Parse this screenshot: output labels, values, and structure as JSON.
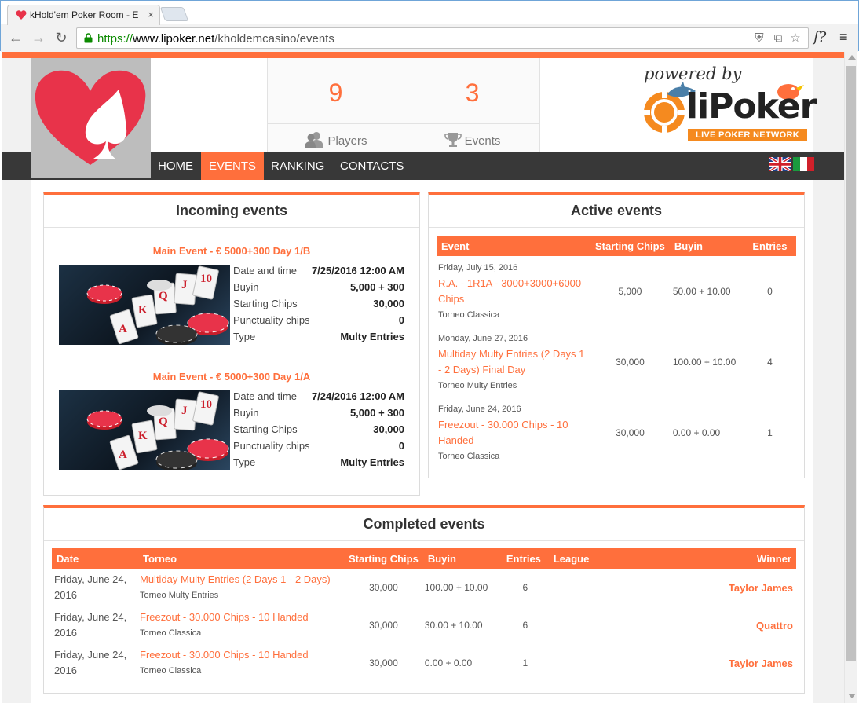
{
  "browser": {
    "tab_title": "kHold'em Poker Room - E",
    "url_scheme": "https://",
    "url_host": "www.lipoker.net",
    "url_path": "/kholdemcasino/events"
  },
  "header": {
    "stats": [
      {
        "value": "9",
        "label": "Players"
      },
      {
        "value": "3",
        "label": "Events"
      }
    ],
    "sponsor": {
      "powered_by": "powered by",
      "brand_prefix": "li",
      "brand_main": "Poker",
      "tagline": "LIVE POKER NETWORK"
    }
  },
  "nav": {
    "items": [
      {
        "label": "HOME"
      },
      {
        "label": "EVENTS"
      },
      {
        "label": "RANKING"
      },
      {
        "label": "CONTACTS"
      }
    ],
    "active": "EVENTS"
  },
  "incoming": {
    "title": "Incoming events",
    "events": [
      {
        "name": "Main Event - € 5000+300 Day 1/B",
        "rows": [
          {
            "key": "Date and time",
            "value": "7/25/2016 12:00 AM"
          },
          {
            "key": "Buyin",
            "value": "5,000 + 300"
          },
          {
            "key": "Starting Chips",
            "value": "30,000"
          },
          {
            "key": "Punctuality chips",
            "value": "0"
          },
          {
            "key": "Type",
            "value": "Multy Entries"
          }
        ]
      },
      {
        "name": "Main Event - € 5000+300 Day 1/A",
        "rows": [
          {
            "key": "Date and time",
            "value": "7/24/2016 12:00 AM"
          },
          {
            "key": "Buyin",
            "value": "5,000 + 300"
          },
          {
            "key": "Starting Chips",
            "value": "30,000"
          },
          {
            "key": "Punctuality chips",
            "value": "0"
          },
          {
            "key": "Type",
            "value": "Multy Entries"
          }
        ]
      }
    ]
  },
  "active": {
    "title": "Active events",
    "columns": [
      "Event",
      "Starting Chips",
      "Buyin",
      "Entries"
    ],
    "rows": [
      {
        "date": "Friday, July 15, 2016",
        "name": "R.A. - 1R1A - 3000+3000+6000 Chips",
        "type": "Torneo Classica",
        "chips": "5,000",
        "buyin": "50.00 + 10.00",
        "entries": "0"
      },
      {
        "date": "Monday, June 27, 2016",
        "name": "Multiday Multy Entries (2 Days 1 - 2 Days) Final Day",
        "type": "Torneo Multy Entries",
        "chips": "30,000",
        "buyin": "100.00 + 10.00",
        "entries": "4"
      },
      {
        "date": "Friday, June 24, 2016",
        "name": "Freezout - 30.000 Chips - 10 Handed",
        "type": "Torneo Classica",
        "chips": "30,000",
        "buyin": "0.00 + 0.00",
        "entries": "1"
      }
    ]
  },
  "completed": {
    "title": "Completed events",
    "columns": [
      "Date",
      "Torneo",
      "Starting Chips",
      "Buyin",
      "Entries",
      "League",
      "Winner"
    ],
    "rows": [
      {
        "date": "Friday, June 24, 2016",
        "name": "Multiday Multy Entries (2 Days 1 - 2 Days)",
        "type": "Torneo Multy Entries",
        "chips": "30,000",
        "buyin": "100.00 + 10.00",
        "entries": "6",
        "league": "",
        "winner": "Taylor James"
      },
      {
        "date": "Friday, June 24, 2016",
        "name": "Freezout - 30.000 Chips - 10 Handed",
        "type": "Torneo Classica",
        "chips": "30,000",
        "buyin": "30.00 + 10.00",
        "entries": "6",
        "league": "",
        "winner": "Quattro"
      },
      {
        "date": "Friday, June 24, 2016",
        "name": "Freezout - 30.000 Chips - 10 Handed",
        "type": "Torneo Classica",
        "chips": "30,000",
        "buyin": "0.00 + 0.00",
        "entries": "1",
        "league": "",
        "winner": "Taylor James"
      }
    ]
  },
  "colors": {
    "accent": "#ff6f3c",
    "nav": "#383838"
  }
}
